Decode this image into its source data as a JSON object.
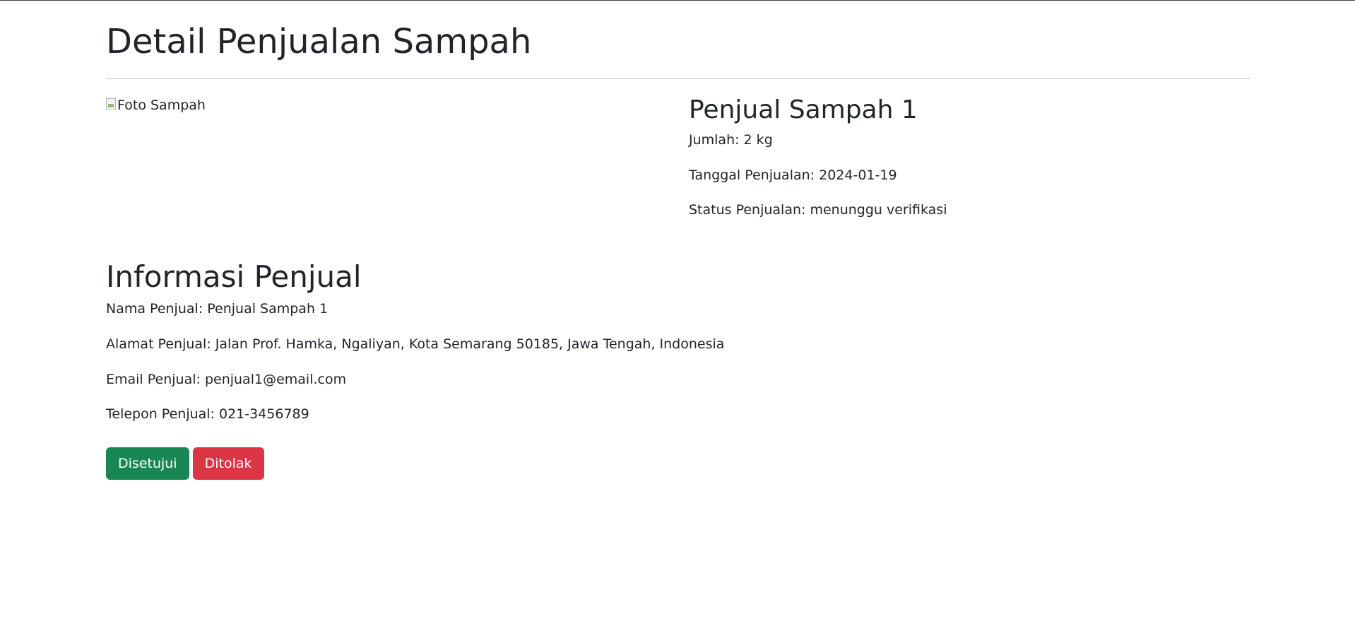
{
  "header": {
    "title": "Detail Penjualan Sampah"
  },
  "photo": {
    "alt": "Foto Sampah"
  },
  "sale": {
    "seller_name": "Penjual Sampah 1",
    "jumlah": "Jumlah: 2 kg",
    "tanggal": "Tanggal Penjualan: 2024-01-19",
    "status": "Status Penjualan: menunggu verifikasi"
  },
  "seller_info": {
    "title": "Informasi Penjual",
    "nama": "Nama Penjual: Penjual Sampah 1",
    "alamat": "Alamat Penjual: Jalan Prof. Hamka, Ngaliyan, Kota Semarang 50185, Jawa Tengah, Indonesia",
    "email": "Email Penjual: penjual1@email.com",
    "telepon": "Telepon Penjual: 021-3456789"
  },
  "actions": {
    "approve_label": "Disetujui",
    "reject_label": "Ditolak"
  },
  "colors": {
    "approve": "#198754",
    "reject": "#dc3545",
    "text": "#212529"
  },
  "icons": {
    "photo": "broken-image-icon"
  }
}
